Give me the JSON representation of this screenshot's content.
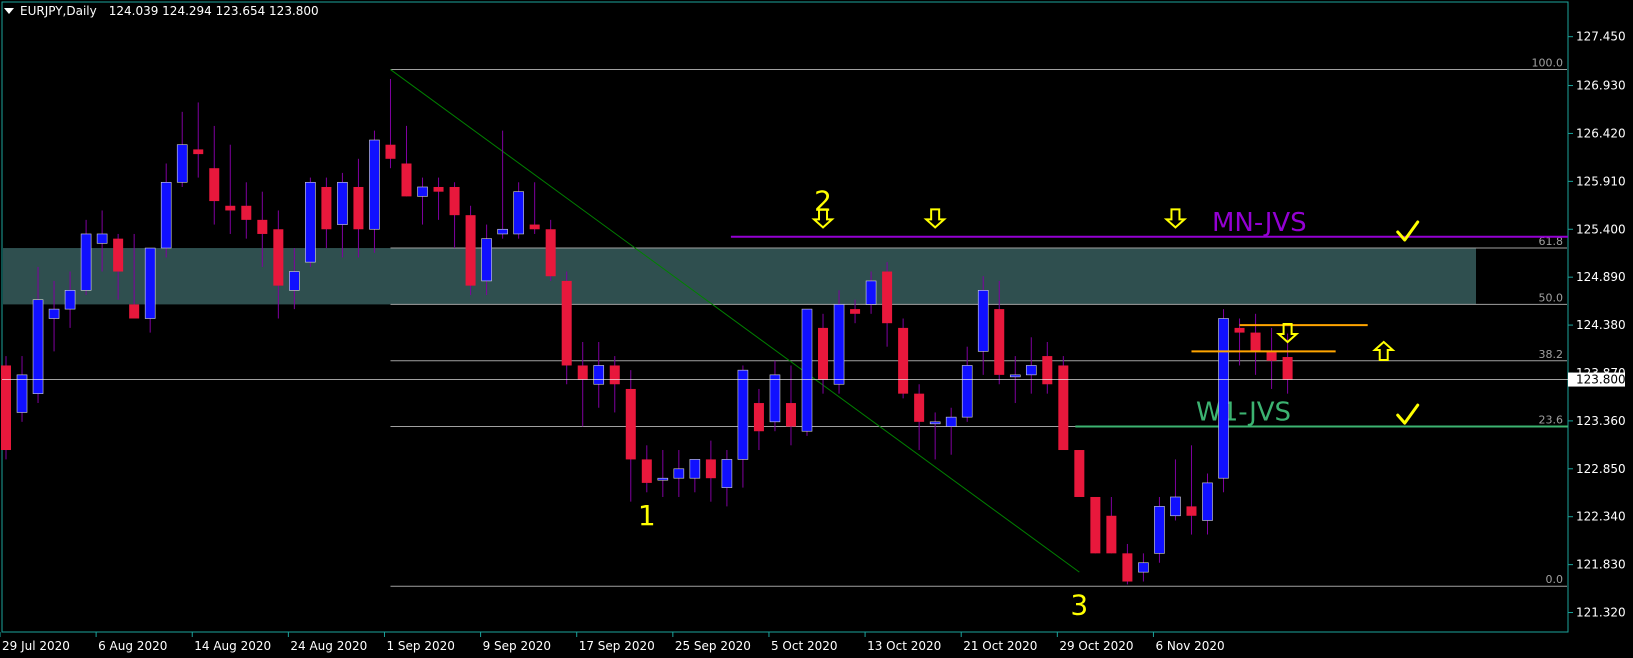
{
  "header": {
    "symbol": "EURJPY,Daily",
    "ohlc": "124.039 124.294 123.654 123.800"
  },
  "colors": {
    "background": "#000000",
    "bull_body": "#1010ff",
    "bear_body": "#e8183c",
    "wick": "#8000a0",
    "axis": "#1ba39c",
    "fib_line": "#a0a0a0",
    "zone": "#2f4f4f",
    "mn_jvs": "#9400d3",
    "w1_jvs": "#3cb371",
    "orange": "#ffa500",
    "marker": "#ffff00",
    "trend": "#008000",
    "price_tag": "#ffffff"
  },
  "chart_data": {
    "type": "candlestick",
    "ylim": [
      121.15,
      127.75
    ],
    "y_ticks": [
      "127.450",
      "126.930",
      "126.420",
      "125.910",
      "125.400",
      "124.890",
      "124.380",
      "123.870",
      "123.360",
      "122.850",
      "122.340",
      "121.830",
      "121.320"
    ],
    "x_ticks": [
      {
        "label": "29 Jul 2020",
        "bar": 0
      },
      {
        "label": "6 Aug 2020",
        "bar": 6
      },
      {
        "label": "14 Aug 2020",
        "bar": 12
      },
      {
        "label": "24 Aug 2020",
        "bar": 18
      },
      {
        "label": "1 Sep 2020",
        "bar": 24
      },
      {
        "label": "9 Sep 2020",
        "bar": 30
      },
      {
        "label": "17 Sep 2020",
        "bar": 36
      },
      {
        "label": "25 Sep 2020",
        "bar": 42
      },
      {
        "label": "5 Oct 2020",
        "bar": 48
      },
      {
        "label": "13 Oct 2020",
        "bar": 54
      },
      {
        "label": "21 Oct 2020",
        "bar": 60
      },
      {
        "label": "29 Oct 2020",
        "bar": 66
      },
      {
        "label": "6 Nov 2020",
        "bar": 72
      }
    ],
    "current_price": "123.800",
    "candles": [
      [
        123.95,
        124.05,
        122.95,
        123.05
      ],
      [
        123.45,
        124.05,
        123.35,
        123.85
      ],
      [
        123.65,
        125.0,
        123.55,
        124.65
      ],
      [
        124.45,
        124.85,
        124.1,
        124.55
      ],
      [
        124.55,
        124.95,
        124.35,
        124.75
      ],
      [
        124.75,
        125.5,
        124.7,
        125.35
      ],
      [
        125.25,
        125.6,
        124.95,
        125.35
      ],
      [
        125.3,
        125.35,
        124.65,
        124.95
      ],
      [
        124.6,
        125.35,
        124.45,
        124.45
      ],
      [
        124.45,
        125.1,
        124.3,
        125.2
      ],
      [
        125.2,
        126.1,
        125.1,
        125.9
      ],
      [
        125.9,
        126.65,
        125.85,
        126.3
      ],
      [
        126.25,
        126.75,
        125.95,
        126.2
      ],
      [
        126.05,
        126.5,
        125.45,
        125.7
      ],
      [
        125.65,
        126.3,
        125.35,
        125.6
      ],
      [
        125.65,
        125.9,
        125.3,
        125.5
      ],
      [
        125.5,
        125.8,
        125.0,
        125.35
      ],
      [
        125.4,
        125.6,
        124.45,
        124.8
      ],
      [
        124.75,
        125.2,
        124.55,
        124.95
      ],
      [
        125.05,
        125.95,
        125.0,
        125.9
      ],
      [
        125.85,
        125.95,
        125.2,
        125.4
      ],
      [
        125.45,
        126.0,
        125.1,
        125.9
      ],
      [
        125.85,
        126.15,
        125.1,
        125.4
      ],
      [
        125.4,
        126.45,
        125.15,
        126.35
      ],
      [
        126.3,
        127.0,
        126.05,
        126.15
      ],
      [
        126.1,
        126.5,
        125.75,
        125.75
      ],
      [
        125.75,
        125.95,
        125.45,
        125.85
      ],
      [
        125.85,
        125.95,
        125.5,
        125.8
      ],
      [
        125.85,
        125.9,
        125.2,
        125.55
      ],
      [
        125.55,
        125.65,
        124.7,
        124.8
      ],
      [
        124.85,
        125.45,
        124.7,
        125.3
      ],
      [
        125.35,
        126.45,
        125.3,
        125.4
      ],
      [
        125.35,
        125.9,
        125.3,
        125.8
      ],
      [
        125.45,
        125.9,
        125.35,
        125.4
      ],
      [
        125.4,
        125.5,
        124.85,
        124.9
      ],
      [
        124.85,
        124.95,
        123.75,
        123.95
      ],
      [
        123.95,
        124.2,
        123.3,
        123.8
      ],
      [
        123.75,
        124.2,
        123.5,
        123.95
      ],
      [
        123.95,
        124.05,
        123.45,
        123.75
      ],
      [
        123.7,
        123.9,
        122.5,
        122.95
      ],
      [
        122.95,
        123.1,
        122.6,
        122.7
      ],
      [
        122.75,
        123.05,
        122.55,
        122.75
      ],
      [
        122.75,
        123.05,
        122.55,
        122.85
      ],
      [
        122.75,
        122.95,
        122.6,
        122.95
      ],
      [
        122.95,
        123.15,
        122.5,
        122.75
      ],
      [
        122.65,
        123.05,
        122.45,
        122.95
      ],
      [
        122.95,
        123.95,
        122.65,
        123.9
      ],
      [
        123.55,
        123.7,
        123.05,
        123.25
      ],
      [
        123.35,
        124.0,
        123.25,
        123.85
      ],
      [
        123.55,
        123.95,
        123.1,
        123.3
      ],
      [
        123.25,
        124.55,
        123.2,
        124.55
      ],
      [
        124.35,
        124.5,
        123.65,
        123.8
      ],
      [
        123.75,
        124.75,
        123.65,
        124.6
      ],
      [
        124.55,
        124.65,
        124.4,
        124.5
      ],
      [
        124.6,
        124.95,
        124.5,
        124.85
      ],
      [
        124.95,
        125.05,
        124.15,
        124.4
      ],
      [
        124.35,
        124.45,
        123.6,
        123.65
      ],
      [
        123.65,
        123.75,
        123.05,
        123.35
      ],
      [
        123.35,
        123.45,
        122.95,
        123.35
      ],
      [
        123.3,
        123.5,
        123.0,
        123.4
      ],
      [
        123.4,
        124.15,
        123.35,
        123.95
      ],
      [
        124.1,
        124.9,
        123.85,
        124.75
      ],
      [
        124.55,
        124.85,
        123.75,
        123.85
      ],
      [
        123.85,
        124.05,
        123.55,
        123.85
      ],
      [
        123.85,
        124.25,
        123.65,
        123.95
      ],
      [
        124.05,
        124.2,
        123.65,
        123.75
      ],
      [
        123.95,
        124.05,
        123.15,
        123.05
      ],
      [
        123.05,
        123.05,
        122.75,
        122.55
      ],
      [
        122.55,
        122.55,
        121.95,
        121.95
      ],
      [
        122.35,
        122.55,
        121.95,
        121.95
      ],
      [
        121.95,
        122.05,
        121.62,
        121.65
      ],
      [
        121.75,
        121.95,
        121.65,
        121.85
      ],
      [
        121.95,
        122.55,
        121.85,
        122.45
      ],
      [
        122.35,
        122.95,
        122.3,
        122.55
      ],
      [
        122.45,
        123.1,
        122.15,
        122.35
      ],
      [
        122.3,
        122.8,
        122.15,
        122.7
      ],
      [
        122.75,
        124.55,
        122.6,
        124.45
      ],
      [
        124.35,
        124.45,
        123.95,
        124.3
      ],
      [
        124.3,
        124.5,
        123.85,
        124.1
      ],
      [
        124.1,
        124.35,
        123.7,
        124.0
      ],
      [
        124.04,
        124.29,
        123.65,
        123.8
      ]
    ],
    "fib_levels": [
      {
        "label": "100.0",
        "price": 127.1
      },
      {
        "label": "61.8",
        "price": 125.2
      },
      {
        "label": "50.0",
        "price": 124.6
      },
      {
        "label": "38.2",
        "price": 124.0
      },
      {
        "label": "23.6",
        "price": 123.3
      },
      {
        "label": "0.0",
        "price": 121.6
      }
    ],
    "fib_start_bar": 24,
    "zone": {
      "top": 125.2,
      "bottom": 124.6
    },
    "mn_jvs": {
      "label": "MN-JVS",
      "price": 125.32,
      "from_bar": 45
    },
    "w1_jvs": {
      "label": "W1-JVS",
      "price": 123.3,
      "from_bar": 67
    },
    "trend_line": {
      "from_bar": 24,
      "from_price": 127.1,
      "to_bar": 67,
      "to_price": 121.75
    },
    "orange_lines": [
      {
        "from_bar": 74,
        "to_bar": 83,
        "price": 124.1
      },
      {
        "from_bar": 77,
        "to_bar": 85,
        "price": 124.38
      }
    ],
    "wave_labels": [
      {
        "label": "2",
        "bar": 51,
        "price": 125.6
      },
      {
        "label": "1",
        "bar": 40,
        "price": 122.25
      },
      {
        "label": "3",
        "bar": 67,
        "price": 121.3
      }
    ],
    "down_arrows": [
      {
        "bar": 51,
        "price": 125.42
      },
      {
        "bar": 58,
        "price": 125.42
      },
      {
        "bar": 73,
        "price": 125.42
      },
      {
        "bar": 80,
        "price": 124.2
      }
    ],
    "up_arrows": [
      {
        "bar": 86,
        "price": 124.2
      }
    ],
    "checks": [
      {
        "bar": 86,
        "price": 125.35
      },
      {
        "bar": 86,
        "price": 123.4
      }
    ]
  }
}
